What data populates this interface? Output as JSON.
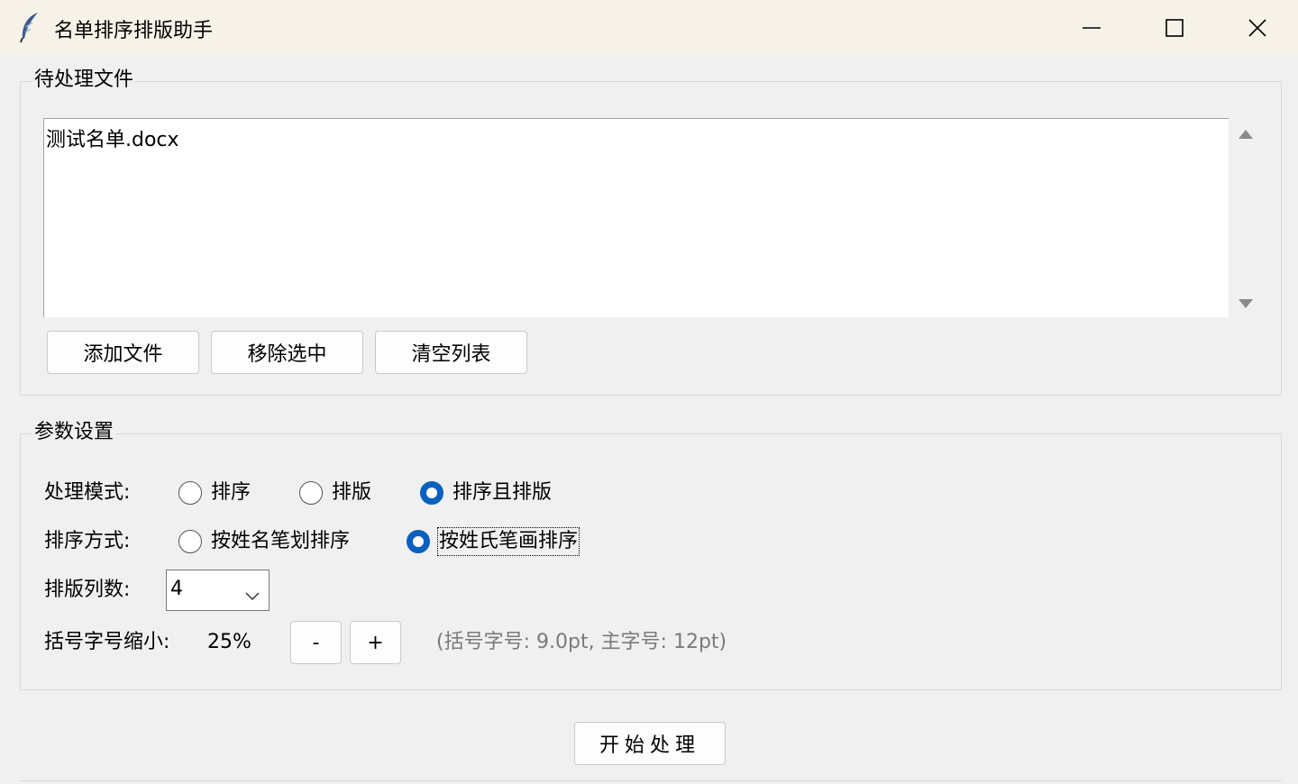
{
  "window": {
    "title": "名单排序排版助手",
    "icon": "feather-icon",
    "controls": [
      "minimize-icon",
      "maximize-icon",
      "close-icon"
    ]
  },
  "files": {
    "group_label": "待处理文件",
    "items": [
      "测试名单.docx"
    ],
    "buttons": {
      "add": "添加文件",
      "remove": "移除选中",
      "clear": "清空列表"
    }
  },
  "params": {
    "group_label": "参数设置",
    "mode": {
      "label": "处理模式:",
      "options": [
        "排序",
        "排版",
        "排序且排版"
      ],
      "selected": "排序且排版"
    },
    "sort": {
      "label": "排序方式:",
      "options": [
        "按姓名笔划排序",
        "按姓氏笔画排序"
      ],
      "selected": "按姓氏笔画排序"
    },
    "columns": {
      "label": "排版列数:",
      "value": "4"
    },
    "bracket": {
      "label": "括号字号缩小:",
      "value": "25%",
      "minus": "-",
      "plus": "+",
      "hint": "(括号字号: 9.0pt, 主字号: 12pt)"
    }
  },
  "start_button": "开始处理",
  "colors": {
    "accent": "#0a5fbf",
    "titlebar": "#f6f2e8",
    "background": "#f0f0f0"
  }
}
